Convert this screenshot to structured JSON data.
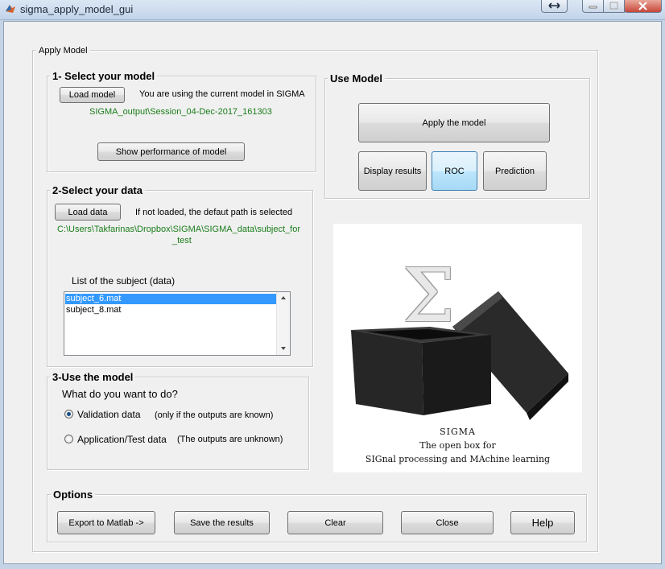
{
  "window": {
    "title": "sigma_apply_model_gui"
  },
  "apply_model": {
    "title": "Apply Model"
  },
  "select_model": {
    "title": "1- Select your model",
    "load_button": "Load model",
    "status_text": "You are using the current model in SIGMA",
    "model_path": "SIGMA_output\\Session_04-Dec-2017_161303",
    "performance_button": "Show performance of  model"
  },
  "use_model": {
    "title": "Use Model",
    "apply_button": "Apply the model",
    "display_button": "Display results",
    "roc_button": "ROC",
    "prediction_button": "Prediction"
  },
  "select_data": {
    "title": "2-Select your data",
    "load_button": "Load data",
    "status_text": "If not loaded, the defaut path is selected",
    "path_line1": "C:\\Users\\Takfarinas\\Dropbox\\SIGMA\\SIGMA_data\\subject_for",
    "path_line2": "_test",
    "list_label": "List of the  subject (data)",
    "subjects": [
      "subject_6.mat",
      "subject_8.mat"
    ],
    "selected_index": 0
  },
  "use_the_model": {
    "title": "3-Use the model",
    "question": "What do you want to do?",
    "options": [
      {
        "label": "Validation data",
        "note": "(only if the outputs are known)",
        "checked": true
      },
      {
        "label": "Application/Test data",
        "note": "(The outputs are unknown)",
        "checked": false
      }
    ]
  },
  "logo": {
    "symbol": "Σ",
    "name": "SIGMA",
    "tagline": "The open box for",
    "subtitle": "SIGnal processing and MAchine learning"
  },
  "options": {
    "title": "Options",
    "export_button": "Export to Matlab ->",
    "save_button": "Save the results",
    "clear_button": "Clear",
    "close_button": "Close",
    "help_button": "Help"
  },
  "colors": {
    "path_text": "#1a7d1a",
    "selection": "#3399ff",
    "title_bar": "#c2d4ea"
  }
}
